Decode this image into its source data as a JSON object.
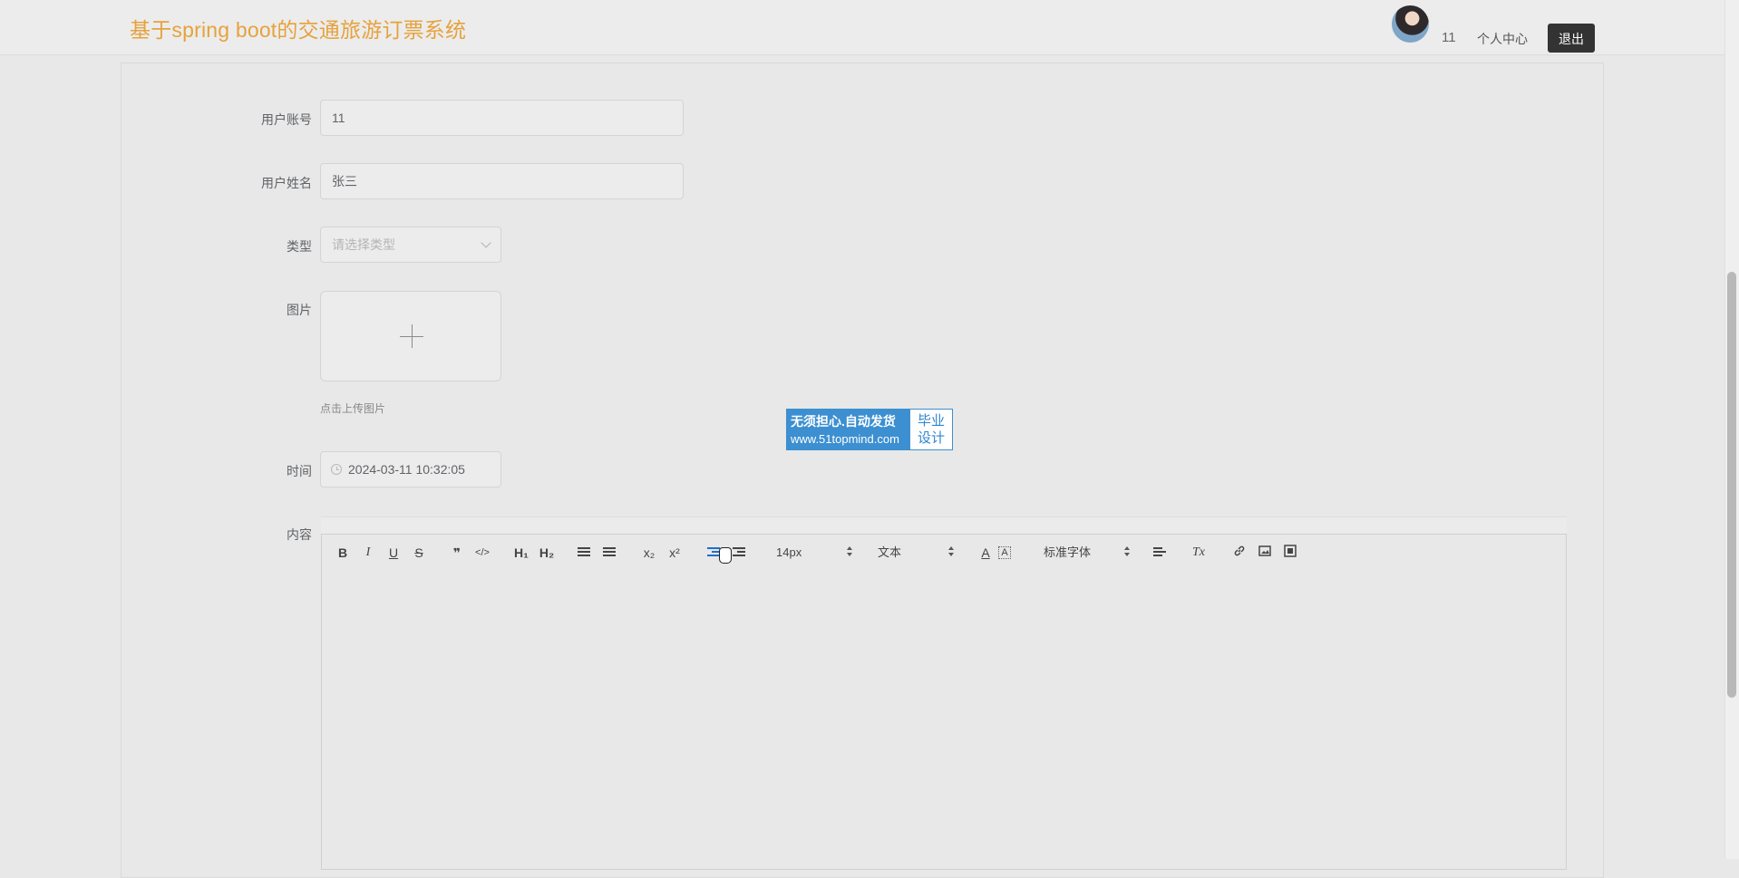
{
  "header": {
    "title": "基于spring boot的交通旅游订票系统",
    "username": "11",
    "center_link": "个人中心",
    "logout_label": "退出"
  },
  "form": {
    "account": {
      "label": "用户账号",
      "value": "11"
    },
    "name": {
      "label": "用户姓名",
      "value": "张三"
    },
    "type": {
      "label": "类型",
      "placeholder": "请选择类型"
    },
    "image": {
      "label": "图片",
      "tip": "点击上传图片"
    },
    "time": {
      "label": "时间",
      "value": "2024-03-11 10:32:05"
    },
    "content": {
      "label": "内容"
    }
  },
  "watermark": {
    "line1": "无须担心.自动发货",
    "line2": "www.51topmind.com",
    "right_line1": "毕业",
    "right_line2": "设计"
  },
  "editor": {
    "font_size": "14px",
    "block_type": "文本",
    "font_family": "标准字体",
    "sub_label": "x₂",
    "sup_label": "x²",
    "h1_label": "H₁",
    "h2_label": "H₂",
    "bold_label": "B",
    "italic_label": "I",
    "underline_label": "U",
    "strike_label": "S",
    "quote_label": "❞",
    "code_label": "</>",
    "color_label": "A",
    "bg_label": "A",
    "clear_label": "Tx"
  }
}
